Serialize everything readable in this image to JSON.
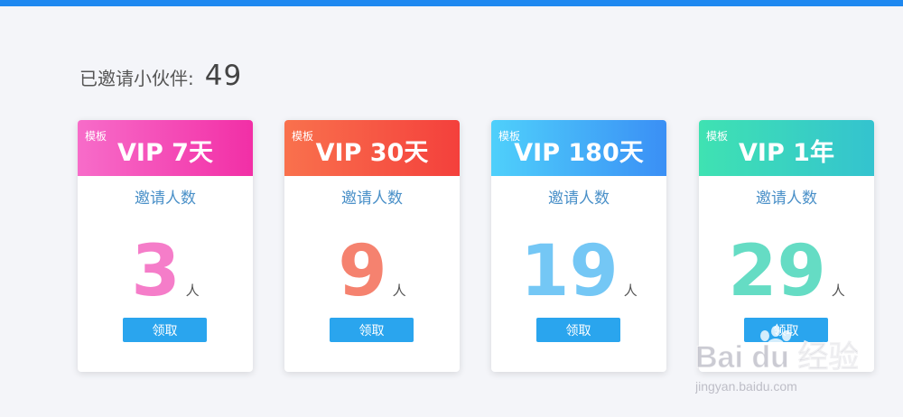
{
  "invite": {
    "label": "已邀请小伙伴:",
    "count": "49"
  },
  "cards": [
    {
      "tag": "模板",
      "title": "VIP 7天",
      "subtitle": "邀请人数",
      "count": "3",
      "unit": "人",
      "button_label": "领取",
      "header_gradient": [
        "#f76cc9",
        "#f22fa6"
      ],
      "number_color": "#f57dc9"
    },
    {
      "tag": "模板",
      "title": "VIP 30天",
      "subtitle": "邀请人数",
      "count": "9",
      "unit": "人",
      "button_label": "领取",
      "header_gradient": [
        "#f9714d",
        "#f4403c"
      ],
      "number_color": "#f5826f"
    },
    {
      "tag": "模板",
      "title": "VIP 180天",
      "subtitle": "邀请人数",
      "count": "19",
      "unit": "人",
      "button_label": "领取",
      "header_gradient": [
        "#4fd0fb",
        "#3a8ff5"
      ],
      "number_color": "#74c7f5"
    },
    {
      "tag": "模板",
      "title": "VIP 1年",
      "subtitle": "邀请人数",
      "count": "29",
      "unit": "人",
      "button_label": "领取",
      "header_gradient": [
        "#3fe2b2",
        "#34c3cf"
      ],
      "number_color": "#65dcc4"
    }
  ],
  "watermark": {
    "brand_text": "Bai du 经验",
    "url": "jingyan.baidu.com"
  },
  "colors": {
    "top_bar": "#1e88f0",
    "button": "#2aa5ee",
    "subtitle": "#4a90c8"
  }
}
